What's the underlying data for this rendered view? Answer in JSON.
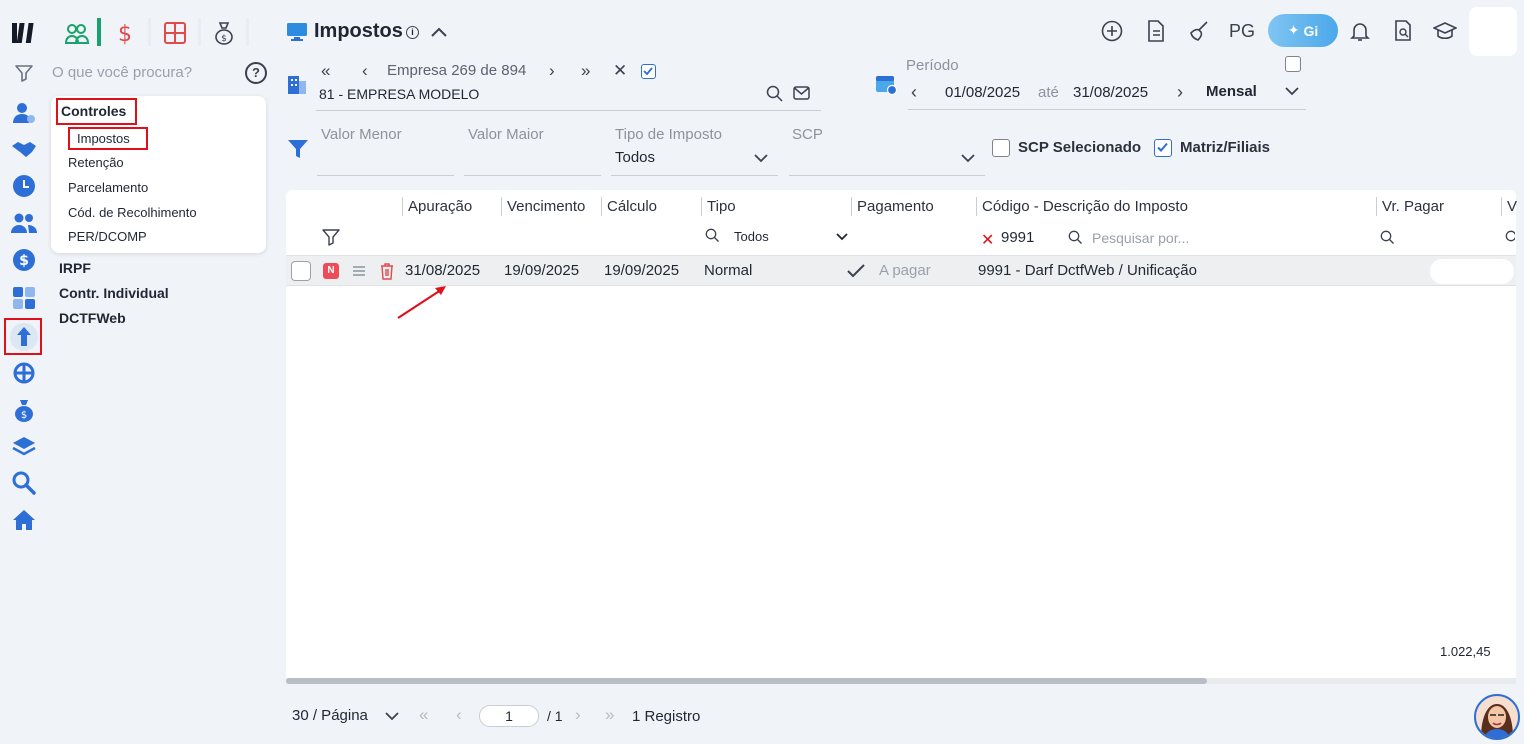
{
  "header": {
    "title": "Impostos",
    "pg_label": "PG",
    "gi_label": "Gi"
  },
  "search": {
    "placeholder": "O que você procura?"
  },
  "menu": {
    "section": "Controles",
    "items": [
      "Impostos",
      "Retenção",
      "Parcelamento",
      "Cód. de Recolhimento",
      "PER/DCOMP"
    ],
    "extra": [
      "IRPF",
      "Contr. Individual",
      "DCTFWeb"
    ]
  },
  "company": {
    "label": "Empresa",
    "current": "269",
    "of": "de",
    "total": "894",
    "name": "81 - EMPRESA MODELO"
  },
  "period": {
    "label": "Período",
    "start": "01/08/2025",
    "until": "até",
    "end": "31/08/2025",
    "mode": "Mensal"
  },
  "filters": {
    "valor_menor": "Valor Menor",
    "valor_maior": "Valor Maior",
    "tipo_label": "Tipo de Imposto",
    "tipo_value": "Todos",
    "scp_label": "SCP",
    "scp_selecionado": "SCP Selecionado",
    "matriz_filiais": "Matriz/Filiais",
    "scp_selecionado_checked": false,
    "matriz_filiais_checked": true
  },
  "table": {
    "columns": [
      "Apuração",
      "Vencimento",
      "Cálculo",
      "Tipo",
      "Pagamento",
      "Código - Descrição do Imposto",
      "Vr. Pagar",
      "V"
    ],
    "tipo_filter": "Todos",
    "codigo_filter": "9991",
    "search_placeholder": "Pesquisar por...",
    "rows": [
      {
        "badge": "N",
        "apuracao": "31/08/2025",
        "vencimento": "19/09/2025",
        "calculo": "19/09/2025",
        "tipo": "Normal",
        "pagamento": "A pagar",
        "codigo": "9991 - Darf DctfWeb / Unificação"
      }
    ],
    "total": "1.022,45"
  },
  "pagination": {
    "per_page": "30 / Página",
    "page": "1",
    "of": "/ 1",
    "records": "1 Registro"
  },
  "colors": {
    "accent": "#2d6fd6",
    "highlight": "#e0101a",
    "background": "#f0f3f8"
  }
}
